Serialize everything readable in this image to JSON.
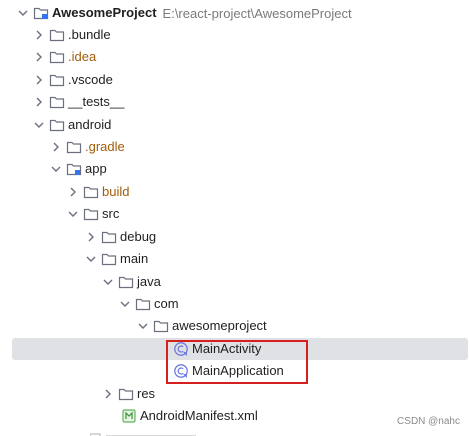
{
  "project": {
    "name": "AwesomeProject",
    "path": "E:\\react-project\\AwesomeProject"
  },
  "tree": [
    {
      "key": "bundle",
      "label": ".bundle",
      "style": "normal"
    },
    {
      "key": "idea",
      "label": ".idea",
      "style": "excluded"
    },
    {
      "key": "vscode",
      "label": ".vscode",
      "style": "normal"
    },
    {
      "key": "tests",
      "label": "__tests__",
      "style": "normal"
    },
    {
      "key": "android",
      "label": "android",
      "style": "normal"
    },
    {
      "key": "gradle",
      "label": ".gradle",
      "style": "excluded"
    },
    {
      "key": "app",
      "label": "app",
      "style": "normal"
    },
    {
      "key": "build",
      "label": "build",
      "style": "excluded"
    },
    {
      "key": "src",
      "label": "src",
      "style": "normal"
    },
    {
      "key": "debug",
      "label": "debug",
      "style": "normal"
    },
    {
      "key": "main",
      "label": "main",
      "style": "normal"
    },
    {
      "key": "java",
      "label": "java",
      "style": "normal"
    },
    {
      "key": "com",
      "label": "com",
      "style": "normal"
    },
    {
      "key": "awesomeproject",
      "label": "awesomeproject",
      "style": "normal"
    },
    {
      "key": "mainactivity",
      "label": "MainActivity",
      "style": "normal"
    },
    {
      "key": "mainapplication",
      "label": "MainApplication",
      "style": "normal"
    },
    {
      "key": "res",
      "label": "res",
      "style": "normal"
    },
    {
      "key": "manifest",
      "label": "AndroidManifest.xml",
      "style": "normal"
    }
  ],
  "watermark": "CSDN @nahc",
  "colors": {
    "selected_bg": "#dfe1e5",
    "highlight_border": "#d62020",
    "excluded_text": "#a15c08",
    "class_icon": "#6e7be0"
  },
  "icons": {
    "folder": "folder-icon",
    "module": "module-folder-icon",
    "class": "kotlin-class-icon",
    "xml": "xml-file-icon",
    "expand": "chevron-down-icon",
    "collapse": "chevron-right-icon"
  }
}
